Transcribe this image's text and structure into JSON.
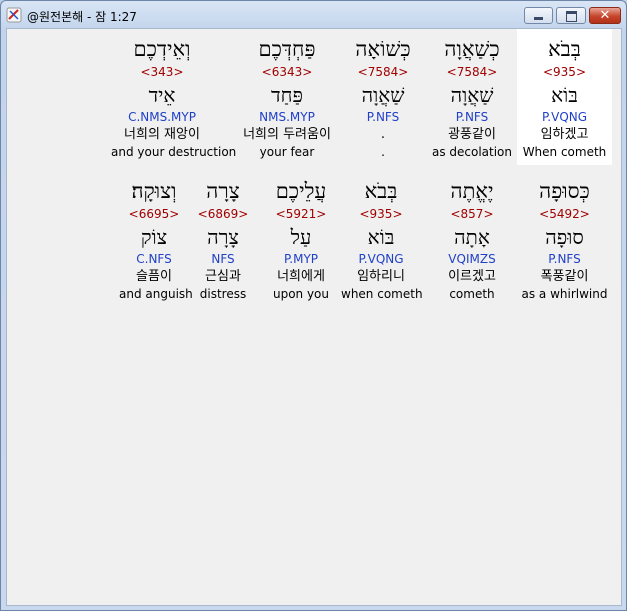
{
  "window": {
    "title": "@원전본해 - 잠 1:27",
    "icons": {
      "app": "bible-app-icon",
      "minimize": "minimize-icon",
      "maximize": "maximize-icon",
      "close": "close-icon"
    },
    "close_glyph": "✕"
  },
  "rows": [
    [
      {
        "hebrew": "בְּבֹא",
        "strong": "<935>",
        "lexeme": "בּוֹא",
        "parse": "P.VQNG",
        "korean": "임하겠고",
        "english": "When cometh",
        "highlighted": true
      },
      {
        "hebrew": "כְשַׁאֲוָה",
        "strong": "<7584>",
        "lexeme": "שַׁאֲוָה",
        "parse": "P.NFS",
        "korean": "광풍같이",
        "english": "as decolation",
        "highlighted": false
      },
      {
        "hebrew": "כְּשׁוֹאָה",
        "strong": "<7584>",
        "lexeme": "שַׁאֲוָה",
        "parse": "P.NFS",
        "korean": ".",
        "english": ".",
        "highlighted": false
      },
      {
        "hebrew": "פַּחְדְּכֶם",
        "strong": "<6343>",
        "lexeme": "פַּחַד",
        "parse": "NMS.MYP",
        "korean": "너희의 두려움이",
        "english": "your fear",
        "highlighted": false
      },
      {
        "hebrew": "וְאֵידְכֶם",
        "strong": "<343>",
        "lexeme": "אֵיד",
        "parse": "C.NMS.MYP",
        "korean": "너희의 재앙이",
        "english": "and your destruction",
        "highlighted": false
      }
    ],
    [
      {
        "hebrew": "כְּסוּפָה",
        "strong": "<5492>",
        "lexeme": "סוּפָה",
        "parse": "P.NFS",
        "korean": "폭풍같이",
        "english": "as a whirlwind",
        "highlighted": false
      },
      {
        "hebrew": "יֶאֱתֶה",
        "strong": "<857>",
        "lexeme": "אָתָה",
        "parse": "VQIMZS",
        "korean": "이르겠고",
        "english": "cometh",
        "highlighted": false
      },
      {
        "hebrew": "בְּבֹא",
        "strong": "<935>",
        "lexeme": "בּוֹא",
        "parse": "P.VQNG",
        "korean": "임하리니",
        "english": "when cometh",
        "highlighted": false
      },
      {
        "hebrew": "עֲלֵיכֶם",
        "strong": "<5921>",
        "lexeme": "עַל",
        "parse": "P.MYP",
        "korean": "너희에게",
        "english": "upon you",
        "highlighted": false
      },
      {
        "hebrew": "צָרָה",
        "strong": "<6869>",
        "lexeme": "צָרָה",
        "parse": "NFS",
        "korean": "근심과",
        "english": "distress",
        "highlighted": false
      },
      {
        "hebrew": "וְצוּקָה׃",
        "strong": "<6695>",
        "lexeme": "צוֹק",
        "parse": "C.NFS",
        "korean": "슬픔이",
        "english": "and anguish",
        "highlighted": false
      }
    ]
  ],
  "colors": {
    "strong": "#a00000",
    "parse": "#2040c8",
    "highlight": "#ffffff",
    "client_bg": "#f0f0f0"
  }
}
